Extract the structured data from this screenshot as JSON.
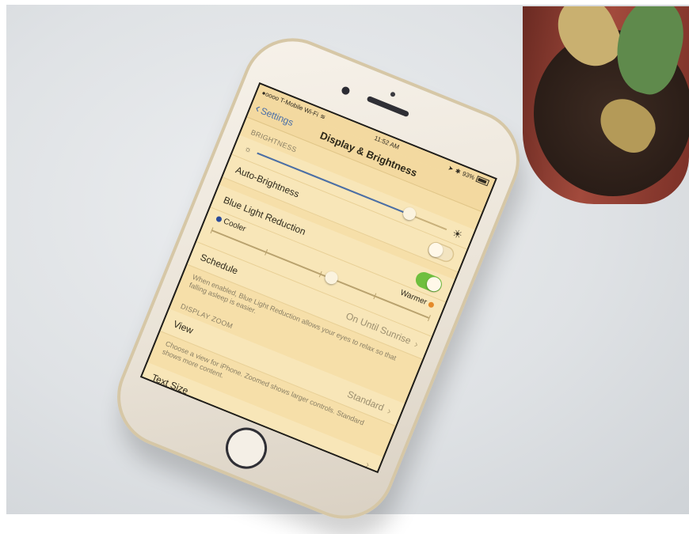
{
  "status_bar": {
    "carrier": "●oooo T-Mobile Wi-Fi",
    "wifi_icon": "wifi-icon",
    "time": "11:52 AM",
    "battery": "93%"
  },
  "nav": {
    "back_label": "Settings",
    "title": "Display & Brightness"
  },
  "brightness": {
    "section_label": "BRIGHTNESS",
    "slider_level": 0.8,
    "auto_label": "Auto-Brightness",
    "auto_on": false
  },
  "blue_light": {
    "label": "Blue Light Reduction",
    "on": true,
    "cooler_label": "Cooler",
    "warmer_label": "Warmer",
    "cooler_color": "#2a4a9a",
    "warmer_color": "#e48a2a",
    "temperature_level": 0.55,
    "schedule_label": "Schedule",
    "schedule_value": "On Until Sunrise",
    "footnote": "When enabled, Blue Light Reduction allows your eyes to relax so that falling asleep is easier."
  },
  "display_zoom": {
    "section_label": "DISPLAY ZOOM",
    "view_label": "View",
    "view_value": "Standard",
    "footnote": "Choose a view for iPhone. Zoomed shows larger controls. Standard shows more content."
  },
  "text_size": {
    "label": "Text Size"
  },
  "colors": {
    "screen_tint": "#f6dfa9",
    "toggle_on": "#6fbf3e",
    "accent": "#4a6fa8"
  }
}
